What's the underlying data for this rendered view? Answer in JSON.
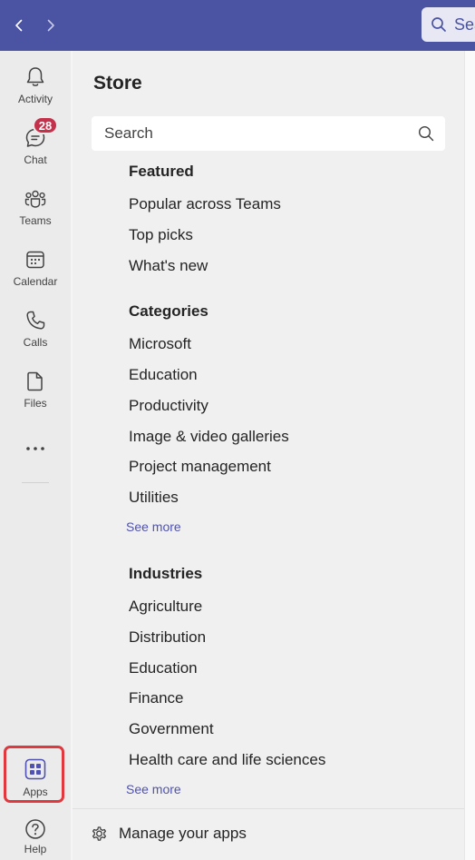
{
  "topbar": {
    "back_icon": "chevron-left-icon",
    "forward_icon": "chevron-right-icon",
    "search_placeholder": "Sea",
    "colors": {
      "bar": "#4b53a3"
    }
  },
  "rail": {
    "items": [
      {
        "id": "activity",
        "label": "Activity",
        "icon": "bell-icon"
      },
      {
        "id": "chat",
        "label": "Chat",
        "icon": "chat-icon",
        "badge": "28"
      },
      {
        "id": "teams",
        "label": "Teams",
        "icon": "teams-icon"
      },
      {
        "id": "calendar",
        "label": "Calendar",
        "icon": "calendar-icon"
      },
      {
        "id": "calls",
        "label": "Calls",
        "icon": "phone-icon"
      },
      {
        "id": "files",
        "label": "Files",
        "icon": "file-icon"
      }
    ],
    "more_icon": "more-dots-icon",
    "apps": {
      "label": "Apps",
      "icon": "apps-grid-icon",
      "highlighted": true
    },
    "help": {
      "label": "Help",
      "icon": "help-icon"
    }
  },
  "store": {
    "title": "Store",
    "search_placeholder": "Search",
    "sections": [
      {
        "heading": "Featured",
        "items": [
          "Popular across Teams",
          "Top picks",
          "What's new"
        ]
      },
      {
        "heading": "Categories",
        "items": [
          "Microsoft",
          "Education",
          "Productivity",
          "Image & video galleries",
          "Project management",
          "Utilities"
        ],
        "see_more": "See more"
      },
      {
        "heading": "Industries",
        "items": [
          "Agriculture",
          "Distribution",
          "Education",
          "Finance",
          "Government",
          "Health care and life sciences"
        ],
        "see_more": "See more"
      }
    ],
    "manage_apps": "Manage your apps"
  },
  "colors": {
    "accent": "#4f52b2",
    "badge": "#c4314b",
    "highlight": "#e0383e"
  }
}
